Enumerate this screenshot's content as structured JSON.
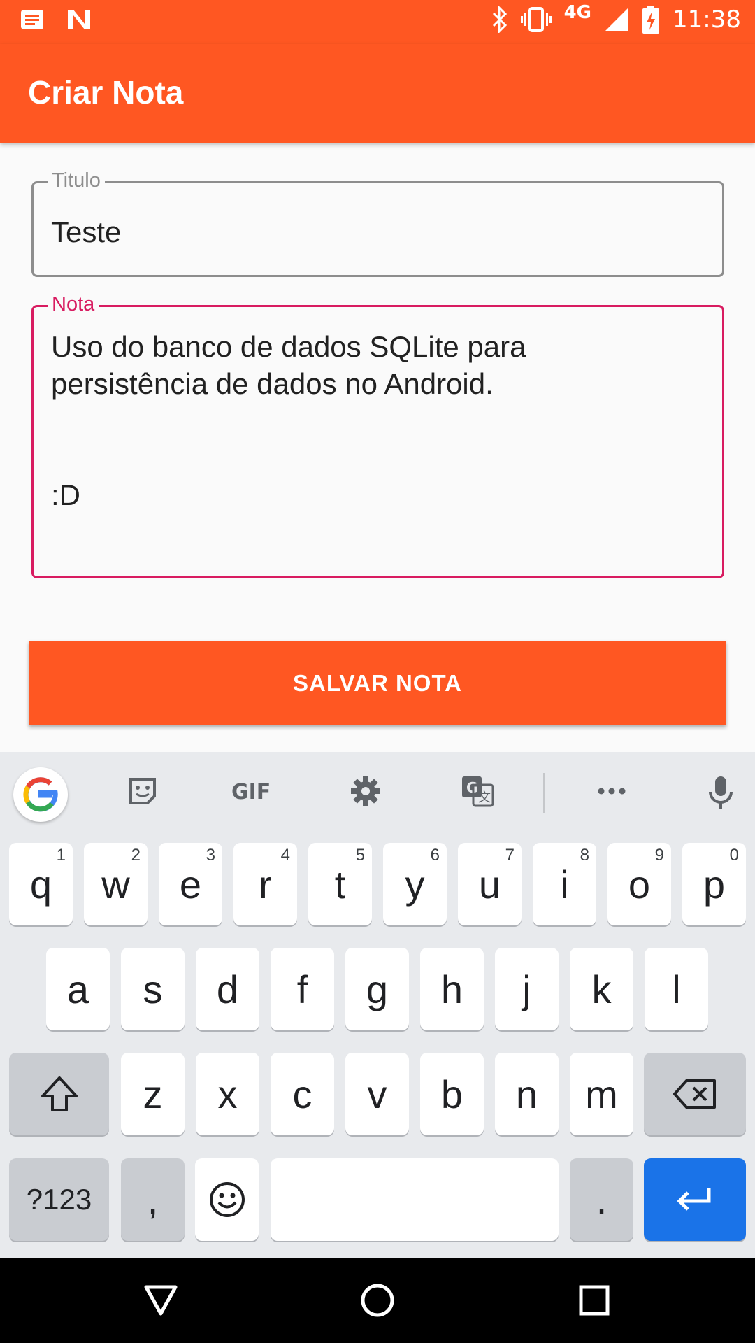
{
  "status_bar": {
    "time": "11:38",
    "network": "4G",
    "icons": [
      "notification-icon",
      "n-icon",
      "bluetooth-icon",
      "vibrate-icon",
      "signal-icon",
      "battery-charging-icon"
    ]
  },
  "app_bar": {
    "title": "Criar Nota"
  },
  "form": {
    "title_field": {
      "label": "Titulo",
      "value": "Teste"
    },
    "note_field": {
      "label": "Nota",
      "value": "Uso do banco de dados SQLite para\npersistência de dados no Android.\n\n\n:D"
    },
    "save_label": "SALVAR NOTA"
  },
  "keyboard": {
    "toolbar": {
      "gif_label": "GIF",
      "icons": [
        "google-icon",
        "sticker-icon",
        "gif-icon",
        "settings-icon",
        "translate-icon",
        "more-icon",
        "mic-icon"
      ]
    },
    "row1": [
      {
        "key": "q",
        "hint": "1"
      },
      {
        "key": "w",
        "hint": "2"
      },
      {
        "key": "e",
        "hint": "3"
      },
      {
        "key": "r",
        "hint": "4"
      },
      {
        "key": "t",
        "hint": "5"
      },
      {
        "key": "y",
        "hint": "6"
      },
      {
        "key": "u",
        "hint": "7"
      },
      {
        "key": "i",
        "hint": "8"
      },
      {
        "key": "o",
        "hint": "9"
      },
      {
        "key": "p",
        "hint": "0"
      }
    ],
    "row2": [
      "a",
      "s",
      "d",
      "f",
      "g",
      "h",
      "j",
      "k",
      "l"
    ],
    "row3": [
      "z",
      "x",
      "c",
      "v",
      "b",
      "n",
      "m"
    ],
    "bottom": {
      "symbols": "?123",
      "comma": ",",
      "period": "."
    }
  }
}
